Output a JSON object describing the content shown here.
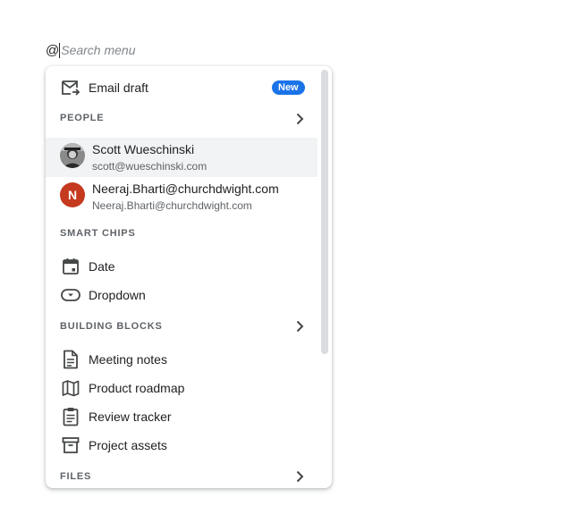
{
  "search": {
    "at": "@",
    "placeholder": "Search menu"
  },
  "menu": {
    "email_draft": {
      "label": "Email draft",
      "badge": "New",
      "icon": "email-draft-icon"
    },
    "people": {
      "header": "PEOPLE",
      "items": [
        {
          "name": "Scott Wueschinski",
          "email": "scott@wueschinski.com",
          "avatar": "photo",
          "highlighted": true
        },
        {
          "name": "Neeraj.Bharti@churchdwight.com",
          "email": "Neeraj.Bharti@churchdwight.com",
          "avatar_letter": "N",
          "highlighted": false
        }
      ]
    },
    "smart_chips": {
      "header": "SMART CHIPS",
      "items": [
        {
          "label": "Date",
          "icon": "calendar-icon"
        },
        {
          "label": "Dropdown",
          "icon": "dropdown-chip-icon"
        }
      ]
    },
    "building_blocks": {
      "header": "BUILDING BLOCKS",
      "items": [
        {
          "label": "Meeting notes",
          "icon": "document-icon"
        },
        {
          "label": "Product roadmap",
          "icon": "map-icon"
        },
        {
          "label": "Review tracker",
          "icon": "clipboard-icon"
        },
        {
          "label": "Project assets",
          "icon": "archive-box-icon"
        }
      ]
    },
    "files": {
      "header": "FILES"
    }
  },
  "colors": {
    "accent": "#1a73e8",
    "highlight": "#f1f3f4",
    "avatar_letter_bg": "#c5391f",
    "section_text": "#5f6368"
  }
}
